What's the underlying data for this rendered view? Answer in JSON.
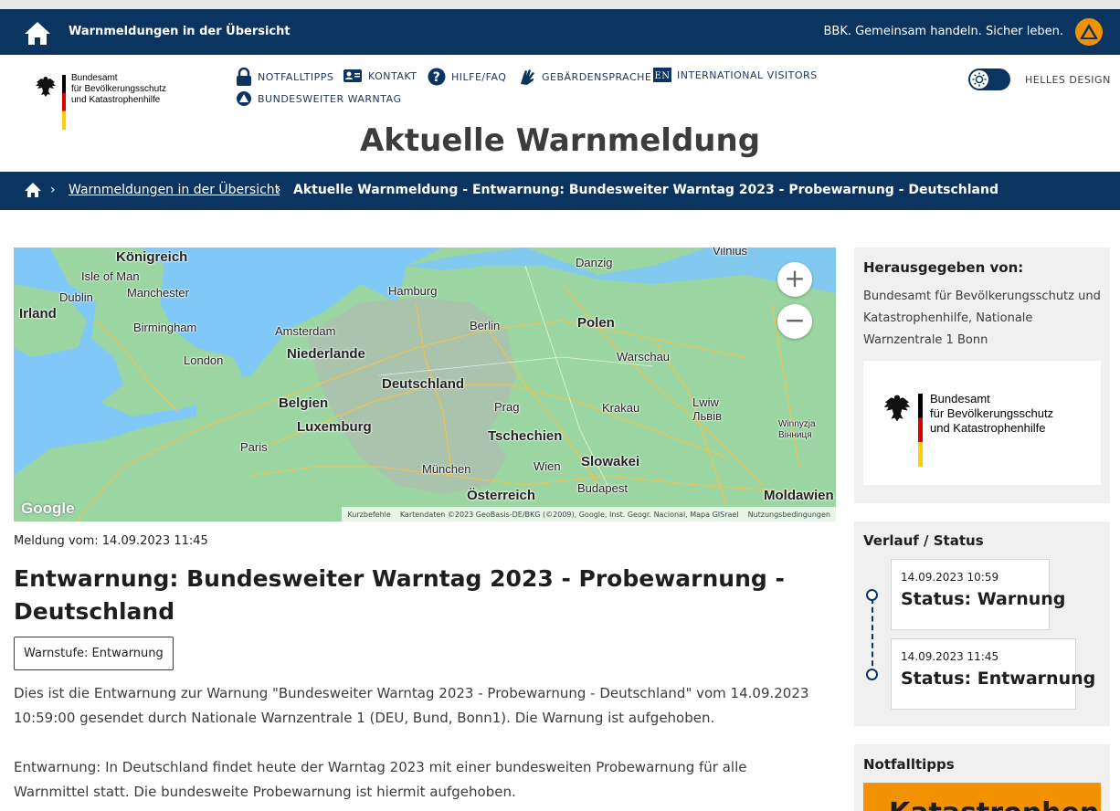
{
  "topbar": {
    "title": "Warnmeldungen in der Übersicht",
    "slogan": "BBK. Gemeinsam handeln. Sicher leben."
  },
  "logo": {
    "line1": "Bundesamt",
    "line2": "für Bevölkerungsschutz",
    "line3": "und Katastrophenhilfe"
  },
  "nav": {
    "items": [
      {
        "label": "NOTFALLTIPPS",
        "icon": "lock-icon"
      },
      {
        "label": "KONTAKT",
        "icon": "contact-card-icon"
      },
      {
        "label": "HILFE/FAQ",
        "icon": "question-icon"
      },
      {
        "label": "GEBÄRDENSPRACHE",
        "icon": "sign-language-icon"
      },
      {
        "label": "INTERNATIONAL VISITORS",
        "icon": "en-badge-icon"
      },
      {
        "label": "BUNDESWEITER WARNTAG",
        "icon": "warntag-icon"
      }
    ],
    "en_badge": "EN"
  },
  "theme": {
    "label": "HELLES DESIGN"
  },
  "page": {
    "title": "Aktuelle Warnmeldung"
  },
  "breadcrumb": {
    "link": "Warnmeldungen in der Übersicht",
    "current": "Aktuelle Warnmeldung - Entwarnung: Bundesweiter Warntag 2023 - Probewarnung - Deutschland"
  },
  "map": {
    "zoom_in": "+",
    "zoom_out": "−",
    "google": "Google",
    "attrib_shortcuts": "Kurzbefehle",
    "attrib_data": "Kartendaten ©2023 GeoBasis-DE/BKG (©2009), Google, Inst. Geogr. Nacional, Mapa GISrael",
    "attrib_terms": "Nutzungsbedingungen",
    "labels": {
      "koenigreich": "Königreich",
      "isle_of_man": "Isle of Man",
      "dublin": "Dublin",
      "irland": "Irland",
      "manchester": "Manchester",
      "birmingham": "Birmingham",
      "london": "London",
      "amsterdam": "Amsterdam",
      "niederlande": "Niederlande",
      "belgien": "Belgien",
      "luxemburg": "Luxemburg",
      "paris": "Paris",
      "hamburg": "Hamburg",
      "berlin": "Berlin",
      "deutschland": "Deutschland",
      "danzig": "Danzig",
      "polen": "Polen",
      "warschau": "Warschau",
      "vilnius": "Vilnius",
      "prag": "Prag",
      "tschechien": "Tschechien",
      "krakau": "Krakau",
      "lwiw": "Lwiw",
      "lwiw_uk": "Львів",
      "winnyzja": "Winnyzja",
      "winnyzja_uk": "Вінниця",
      "muenchen": "München",
      "wien": "Wien",
      "slowakei": "Slowakei",
      "oesterreich": "Österreich",
      "budapest": "Budapest",
      "moldawien": "Moldawien"
    }
  },
  "message": {
    "date_label": "Meldung vom: 14.09.2023 11:45",
    "headline": "Entwarnung: Bundesweiter Warntag 2023 - Probewarnung - Deutschland",
    "badge": "Warnstufe: Entwarnung",
    "para1": "Dies ist die Entwarnung zur Warnung \"Bundesweiter Warntag 2023 - Probewarnung - Deutschland\" vom 14.09.2023 10:59:00 gesendet durch Nationale Warnzentrale 1 (DEU, Bund, Bonn1). Die Warnung ist aufgehoben.",
    "para2": "Entwarnung: In Deutschland findet heute der Warntag 2023 mit einer bundesweiten Probewarnung für alle Warnmittel statt. Die bundesweite Probewarnung ist hiermit aufgehoben."
  },
  "publisher": {
    "heading": "Herausgegeben von:",
    "text": "Bundesamt für Bevölkerungsschutz und Katastrophenhilfe, Nationale Warnzentrale 1 Bonn"
  },
  "status": {
    "heading": "Verlauf / Status",
    "entries": [
      {
        "time": "14.09.2023 10:59",
        "status": "Status: Warnung"
      },
      {
        "time": "14.09.2023 11:45",
        "status": "Status: Entwarnung"
      }
    ]
  },
  "tips": {
    "heading": "Notfalltipps",
    "teaser": "Katastrophen"
  },
  "colors": {
    "primary": "#0c3460",
    "accent": "#f39200",
    "sidebar_bg": "#f0f0f0"
  }
}
